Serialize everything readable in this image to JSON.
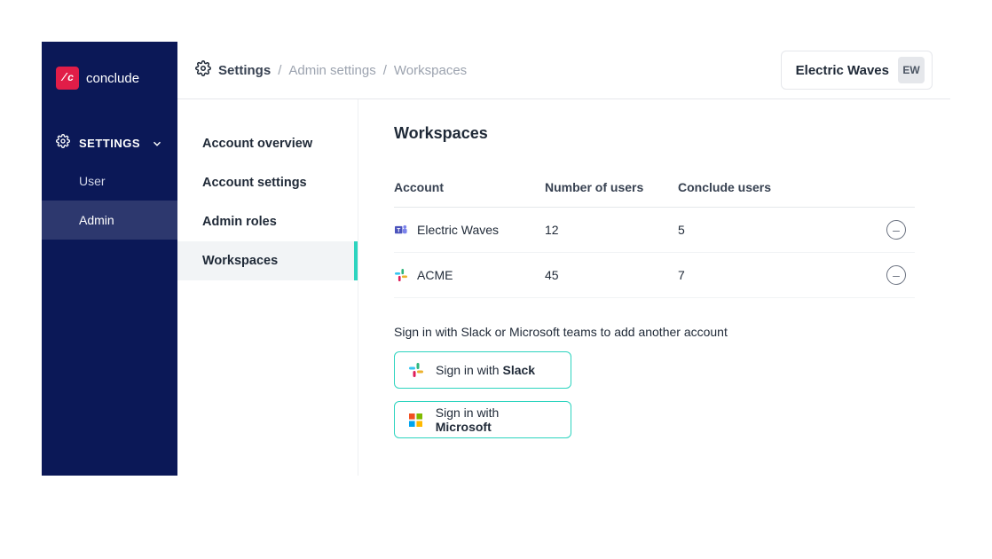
{
  "brand": {
    "name": "conclude",
    "logo_glyph": "/c"
  },
  "primary_nav": {
    "section_label": "SETTINGS",
    "items": [
      {
        "label": "User"
      },
      {
        "label": "Admin"
      }
    ]
  },
  "breadcrumb": {
    "root": "Settings",
    "mid": "Admin settings",
    "leaf": "Workspaces"
  },
  "org": {
    "name": "Electric Waves",
    "initials": "EW"
  },
  "secondary_nav": {
    "items": [
      {
        "label": "Account overview"
      },
      {
        "label": "Account settings"
      },
      {
        "label": "Admin roles"
      },
      {
        "label": "Workspaces"
      }
    ]
  },
  "page_title": "Workspaces",
  "table": {
    "columns": {
      "account": "Account",
      "num_users": "Number of users",
      "conclude_users": "Conclude users"
    },
    "rows": [
      {
        "provider": "teams",
        "name": "Electric Waves",
        "num_users": "12",
        "conclude_users": "5"
      },
      {
        "provider": "slack",
        "name": "ACME",
        "num_users": "45",
        "conclude_users": "7"
      }
    ]
  },
  "signin": {
    "hint": "Sign in with Slack or Microsoft teams to add another account",
    "slack_prefix": "Sign in with ",
    "slack_strong": "Slack",
    "ms_prefix": "Sign in with ",
    "ms_strong": "Microsoft"
  },
  "glyphs": {
    "minus": "–"
  }
}
